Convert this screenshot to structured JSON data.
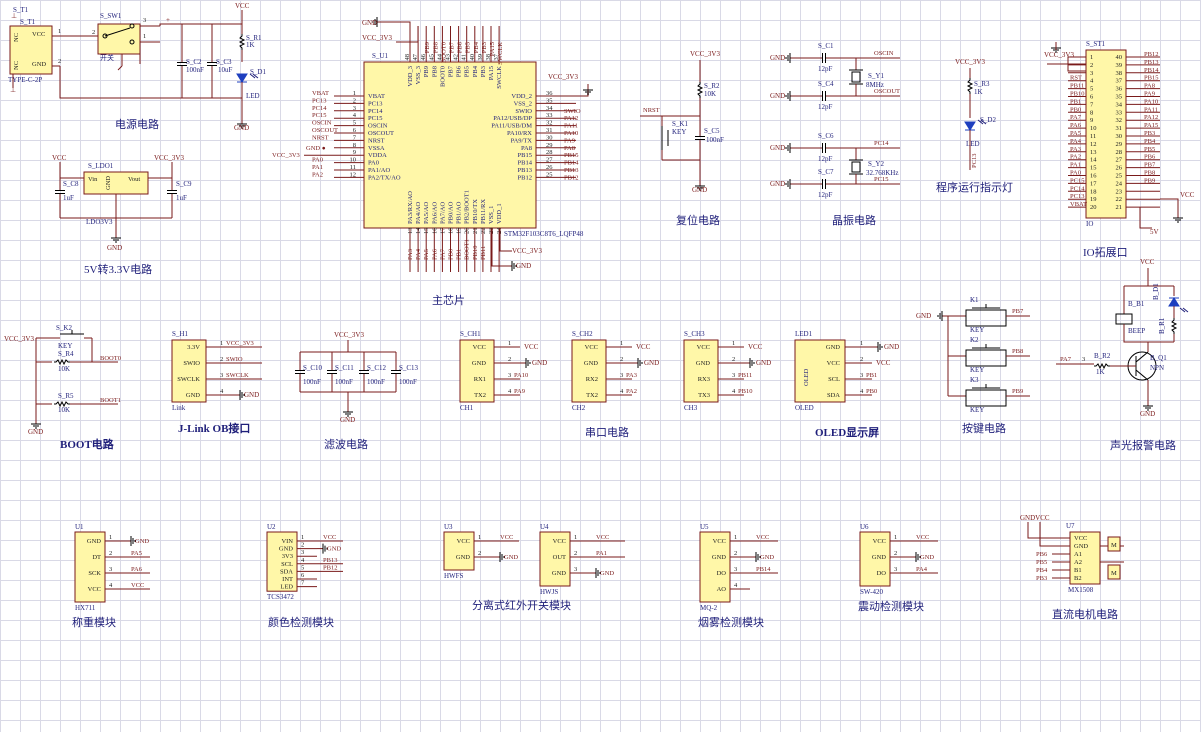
{
  "sections": {
    "power": "电源电路",
    "ldo": "5V转3.3V电路",
    "mcu": "主芯片",
    "reset": "复位电路",
    "crystal": "晶振电路",
    "runled": "程序运行指示灯",
    "io": "IO拓展口",
    "boot": "BOOT电路",
    "jlink": "J-Link OB接口",
    "filter": "滤波电路",
    "uart": "串口电路",
    "oled": "OLED显示屏",
    "keys": "按键电路",
    "alarm": "声光报警电路",
    "hx711": "称重模块",
    "tcs": "颜色检测模块",
    "ir": "分离式红外开关模块",
    "mq2": "烟雾检测模块",
    "sw420": "震动检测模块",
    "motor": "直流电机电路"
  },
  "nets": {
    "vcc": "VCC",
    "v33": "VCC_3V3",
    "gnd": "GND",
    "v3": "3.3V",
    "nrst": "NRST"
  },
  "power": {
    "t1": "S_T1",
    "t1_type": "TYPE-C-2P",
    "t1_nc1": "NC",
    "t1_nc2": "NC",
    "t1_vcc": "VCC",
    "t1_gnd": "GND",
    "sw1": "S_SW1",
    "sw1_label": "开关",
    "c2": "S_C2",
    "c2_val": "100nF",
    "c3": "S_C3",
    "c3_val": "10uF",
    "r1": "S_R1",
    "r1_val": "1K",
    "d1": "S_D1",
    "d1_val": "LED"
  },
  "ldo": {
    "ref": "S_LDO1",
    "vin": "Vin",
    "vout": "Vout",
    "gnd": "GND",
    "part": "LDO3V3",
    "c8": "S_C8",
    "c9": "S_C9",
    "cval": "1uF"
  },
  "mcu": {
    "ref": "S_U1",
    "part": "STM32F103C8T6_LQFP48",
    "left": [
      {
        "n": "1",
        "p": "VBAT",
        "net": "VBAT"
      },
      {
        "n": "2",
        "p": "PC13",
        "net": "PC13"
      },
      {
        "n": "3",
        "p": "PC14",
        "net": "PC14"
      },
      {
        "n": "4",
        "p": "PC15",
        "net": "PC15"
      },
      {
        "n": "5",
        "p": "OSCIN",
        "net": "OSCIN"
      },
      {
        "n": "6",
        "p": "OSCOUT",
        "net": "OSCOUT"
      },
      {
        "n": "7",
        "p": "NRST",
        "net": "NRST"
      },
      {
        "n": "8",
        "p": "VSSA",
        "net": "GND"
      },
      {
        "n": "9",
        "p": "VDDA",
        "net": "VCC_3V3"
      },
      {
        "n": "10",
        "p": "PA0",
        "net": "PA0"
      },
      {
        "n": "11",
        "p": "PA1/AO",
        "net": "PA1"
      },
      {
        "n": "12",
        "p": "PA2/TX/AO",
        "net": "PA2"
      }
    ],
    "right": [
      {
        "n": "36",
        "p": "VDD_2",
        "net": ""
      },
      {
        "n": "35",
        "p": "VSS_2",
        "net": ""
      },
      {
        "n": "34",
        "p": "SWIO",
        "net": "SWIO"
      },
      {
        "n": "33",
        "p": "PA12/USB/DP",
        "net": "PA12"
      },
      {
        "n": "32",
        "p": "PA11/USB/DM",
        "net": "PA11"
      },
      {
        "n": "31",
        "p": "PA10/RX",
        "net": "PA10"
      },
      {
        "n": "30",
        "p": "PA9/TX",
        "net": "PA9"
      },
      {
        "n": "29",
        "p": "PA8",
        "net": "PA8"
      },
      {
        "n": "28",
        "p": "PB15",
        "net": "PB15"
      },
      {
        "n": "27",
        "p": "PB14",
        "net": "PB14"
      },
      {
        "n": "26",
        "p": "PB13",
        "net": "PB13"
      },
      {
        "n": "25",
        "p": "PB12",
        "net": "PB12"
      }
    ],
    "top": [
      {
        "n": "48",
        "p": "VDD_3"
      },
      {
        "n": "47",
        "p": "VSS_3"
      },
      {
        "n": "46",
        "p": "PB9"
      },
      {
        "n": "45",
        "p": "PB8"
      },
      {
        "n": "44",
        "p": "BOOT0"
      },
      {
        "n": "43",
        "p": "PB7"
      },
      {
        "n": "42",
        "p": "PB6"
      },
      {
        "n": "41",
        "p": "PB5"
      },
      {
        "n": "40",
        "p": "PB4"
      },
      {
        "n": "39",
        "p": "PB3"
      },
      {
        "n": "38",
        "p": "PA15"
      },
      {
        "n": "37",
        "p": "SWCLK"
      }
    ],
    "topnets": [
      "",
      "",
      "PB9",
      "PB8",
      "BOOT0",
      "PB7",
      "PB6",
      "PB5",
      "PB4",
      "PB3",
      "PA15",
      "SWCLK"
    ],
    "bottom": [
      {
        "n": "13",
        "p": "PA3/RX/AO"
      },
      {
        "n": "14",
        "p": "PA4/AO"
      },
      {
        "n": "15",
        "p": "PA5/AO"
      },
      {
        "n": "16",
        "p": "PA6/AO"
      },
      {
        "n": "17",
        "p": "PA7/AO"
      },
      {
        "n": "18",
        "p": "PB0/AO"
      },
      {
        "n": "19",
        "p": "PB1/AO"
      },
      {
        "n": "20",
        "p": "PB2/BOOT1"
      },
      {
        "n": "21",
        "p": "PB10/TX"
      },
      {
        "n": "22",
        "p": "PB11/RX"
      },
      {
        "n": "23",
        "p": "VSS_1"
      },
      {
        "n": "24",
        "p": "VDD_1"
      }
    ],
    "bottomnets": [
      "PA3",
      "PA4",
      "PA5",
      "PA6",
      "PA7",
      "PB0",
      "PB1",
      "BOOT1",
      "PB10",
      "PB11",
      "",
      ""
    ]
  },
  "reset": {
    "r2": "S_R2",
    "r2_val": "10K",
    "k1": "S_K1",
    "k1_val": "KEY",
    "c5": "S_C5",
    "c5_val": "100nF"
  },
  "crystal": {
    "c1": "S_C1",
    "c4": "S_C4",
    "c6": "S_C6",
    "c7": "S_C7",
    "cval": "12pF",
    "y1": "S_Y1",
    "y1_val": "8MHz",
    "y2": "S_Y2",
    "y2_val": "32.768KHz",
    "oscin": "OSCIN",
    "oscout": "OSCOUT",
    "pc14": "PC14",
    "pc15": "PC15"
  },
  "runled": {
    "r3": "S_R3",
    "r3_val": "1K",
    "d2": "S_D2",
    "d2_val": "LED",
    "net": "PC13"
  },
  "io": {
    "ref": "S_ST1",
    "part": "IO",
    "left": [
      {
        "n": "1",
        "net": ""
      },
      {
        "n": "2",
        "net": ""
      },
      {
        "n": "3",
        "net": ""
      },
      {
        "n": "4",
        "net": "RST"
      },
      {
        "n": "5",
        "net": "PB11"
      },
      {
        "n": "6",
        "net": "PB10"
      },
      {
        "n": "7",
        "net": "PB1"
      },
      {
        "n": "8",
        "net": "PB0"
      },
      {
        "n": "9",
        "net": "PA7"
      },
      {
        "n": "10",
        "net": "PA6"
      },
      {
        "n": "11",
        "net": "PA5"
      },
      {
        "n": "12",
        "net": "PA4"
      },
      {
        "n": "13",
        "net": "PA3"
      },
      {
        "n": "14",
        "net": "PA2"
      },
      {
        "n": "15",
        "net": "PA1"
      },
      {
        "n": "16",
        "net": "PA0"
      },
      {
        "n": "17",
        "net": "PC15"
      },
      {
        "n": "18",
        "net": "PC14"
      },
      {
        "n": "19",
        "net": "PC13"
      },
      {
        "n": "20",
        "net": "VBAT"
      }
    ],
    "right": [
      {
        "n": "40",
        "net": "PB12"
      },
      {
        "n": "39",
        "net": "PB13"
      },
      {
        "n": "38",
        "net": "PB14"
      },
      {
        "n": "37",
        "net": "PB15"
      },
      {
        "n": "36",
        "net": "PA8"
      },
      {
        "n": "35",
        "net": "PA9"
      },
      {
        "n": "34",
        "net": "PA10"
      },
      {
        "n": "33",
        "net": "PA11"
      },
      {
        "n": "32",
        "net": "PA12"
      },
      {
        "n": "31",
        "net": "PA15"
      },
      {
        "n": "30",
        "net": "PB3"
      },
      {
        "n": "29",
        "net": "PB4"
      },
      {
        "n": "28",
        "net": "PB5"
      },
      {
        "n": "27",
        "net": "PB6"
      },
      {
        "n": "26",
        "net": "PB7"
      },
      {
        "n": "25",
        "net": "PB8"
      },
      {
        "n": "24",
        "net": "PB9"
      },
      {
        "n": "23",
        "net": ""
      },
      {
        "n": "22",
        "net": ""
      },
      {
        "n": "21",
        "net": ""
      }
    ],
    "v5": "5V"
  },
  "boot": {
    "k2": "S_K2",
    "k2_val": "KEY",
    "r4": "S_R4",
    "r5": "S_R5",
    "rval": "10K",
    "boot0": "BOOT0",
    "boot1": "BOOT1"
  },
  "jlink": {
    "ref": "S_H1",
    "part": "Link",
    "pins": [
      {
        "n": "1",
        "p": "3.3V",
        "net": "VCC_3V3"
      },
      {
        "n": "2",
        "p": "SWIO",
        "net": "SWIO"
      },
      {
        "n": "3",
        "p": "SWCLK",
        "net": "SWCLK"
      },
      {
        "n": "4",
        "p": "GND",
        "net": "GND"
      }
    ]
  },
  "filter": {
    "c10": "S_C10",
    "c11": "S_C11",
    "c12": "S_C12",
    "c13": "S_C13",
    "val": "100nF"
  },
  "uart": [
    {
      "ref": "S_CH1",
      "part": "CH1",
      "rx": "PA10",
      "tx": "PA9"
    },
    {
      "ref": "S_CH2",
      "part": "CH2",
      "rx": "PA3",
      "tx": "PA2"
    },
    {
      "ref": "S_CH3",
      "part": "CH3",
      "rx": "PB11",
      "tx": "PB10"
    }
  ],
  "uart_pins": [
    "VCC",
    "GND",
    "RX1",
    "TX2"
  ],
  "uart_pins_alt": [
    "VCC",
    "GND",
    "RX2",
    "TX2"
  ],
  "uart_pins_alt3": [
    "VCC",
    "GND",
    "RX3",
    "TX3"
  ],
  "oled": {
    "ref": "LED1",
    "part": "OLED",
    "label": "OLED",
    "pins": [
      "GND",
      "VCC",
      "SCL",
      "SDA"
    ],
    "scl": "PB1",
    "sda": "PB0"
  },
  "keys": [
    {
      "ref": "K1",
      "val": "KEY",
      "net": "PB7"
    },
    {
      "ref": "K2",
      "val": "KEY",
      "net": "PB8"
    },
    {
      "ref": "K3",
      "val": "KEY",
      "net": "PB9"
    }
  ],
  "alarm": {
    "b1": "B_B1",
    "b1_val": "BEEP",
    "d1": "B_D1",
    "r1": "B_R1",
    "r2": "B_R2",
    "r2_val": "1K",
    "q1": "B_Q1",
    "q1_val": "NPN",
    "net": "PA7"
  },
  "hx711": {
    "ref": "U1",
    "part": "HX711",
    "pins": [
      "GND",
      "DT",
      "SCK",
      "VCC"
    ],
    "nets": [
      "GND",
      "PA5",
      "PA6",
      "VCC"
    ]
  },
  "tcs": {
    "ref": "U2",
    "part": "TCS3472",
    "pins": [
      "VIN",
      "GND",
      "3V3",
      "SCL",
      "SDA",
      "INT",
      "LED"
    ],
    "nets": [
      "VCC",
      "GND",
      "",
      "PB13",
      "PB12",
      "",
      ""
    ]
  },
  "ir": [
    {
      "ref": "U3",
      "part": "HWFS",
      "pins": [
        "VCC",
        "GND"
      ]
    },
    {
      "ref": "U4",
      "part": "HWJS",
      "pins": [
        "VCC",
        "OUT",
        "GND"
      ],
      "net": "PA1"
    }
  ],
  "mq2": {
    "ref": "U5",
    "part": "MQ-2",
    "pins": [
      "VCC",
      "GND",
      "DO",
      "AO"
    ],
    "net": "PB14"
  },
  "sw420": {
    "ref": "U6",
    "part": "SW-420",
    "pins": [
      "VCC",
      "GND",
      "DO"
    ],
    "net": "PA4"
  },
  "motor": {
    "ref": "U7",
    "part": "MX1508",
    "pins": [
      "VCC",
      "GND",
      "A1",
      "A2",
      "B1",
      "B2"
    ],
    "nets": [
      "",
      "",
      "PB6",
      "PB5",
      "PB4",
      "PB3"
    ],
    "m1": "M",
    "m2": "M"
  }
}
